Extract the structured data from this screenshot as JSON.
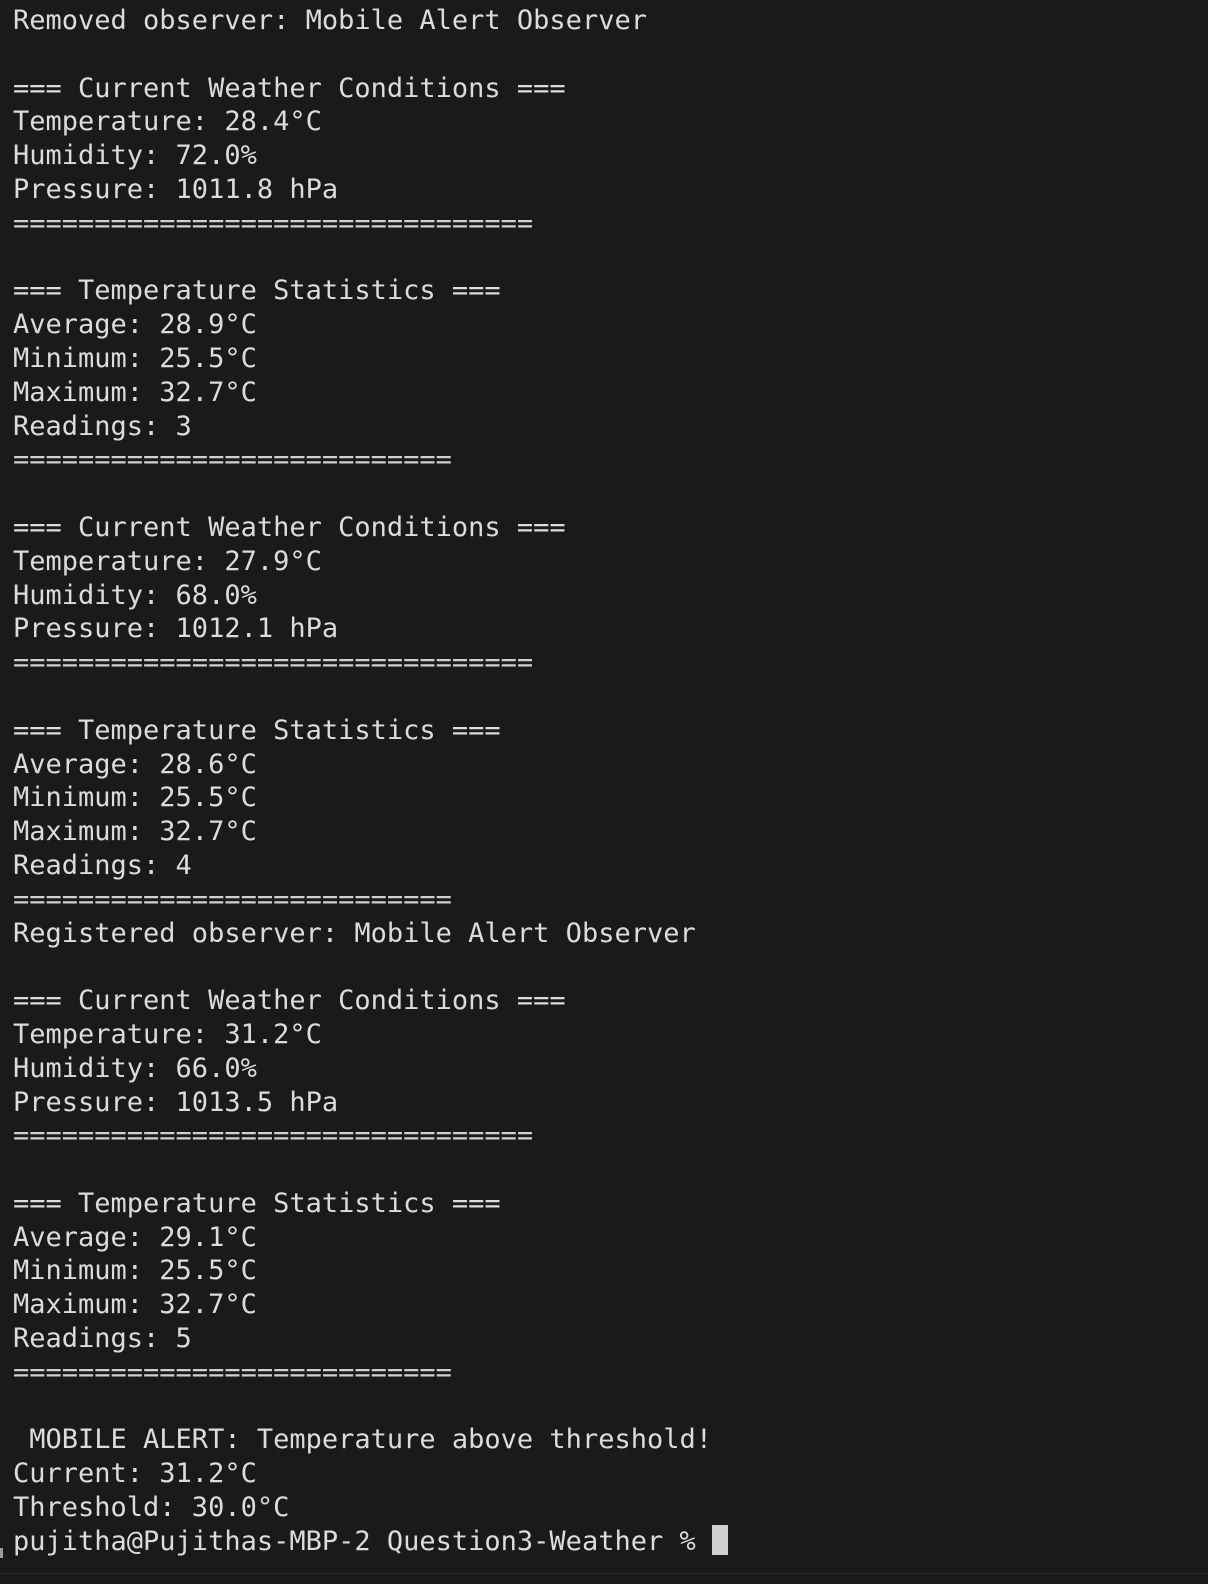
{
  "terminal": {
    "colors": {
      "background": "#1a1a1a",
      "foreground": "#dcdcdc",
      "cursor": "#cfcfcf"
    },
    "lines": [
      "Removed observer: Mobile Alert Observer",
      "",
      "=== Current Weather Conditions ===",
      "Temperature: 28.4°C",
      "Humidity: 72.0%",
      "Pressure: 1011.8 hPa",
      "================================",
      "",
      "=== Temperature Statistics ===",
      "Average: 28.9°C",
      "Minimum: 25.5°C",
      "Maximum: 32.7°C",
      "Readings: 3",
      "===========================",
      "",
      "=== Current Weather Conditions ===",
      "Temperature: 27.9°C",
      "Humidity: 68.0%",
      "Pressure: 1012.1 hPa",
      "================================",
      "",
      "=== Temperature Statistics ===",
      "Average: 28.6°C",
      "Minimum: 25.5°C",
      "Maximum: 32.7°C",
      "Readings: 4",
      "===========================",
      "Registered observer: Mobile Alert Observer",
      "",
      "=== Current Weather Conditions ===",
      "Temperature: 31.2°C",
      "Humidity: 66.0%",
      "Pressure: 1013.5 hPa",
      "================================",
      "",
      "=== Temperature Statistics ===",
      "Average: 29.1°C",
      "Minimum: 25.5°C",
      "Maximum: 32.7°C",
      "Readings: 5",
      "===========================",
      "",
      " MOBILE ALERT: Temperature above threshold!",
      "Current: 31.2°C",
      "Threshold: 30.0°C"
    ],
    "prompt": "pujitha@Pujithas-MBP-2 Question3-Weather % "
  }
}
